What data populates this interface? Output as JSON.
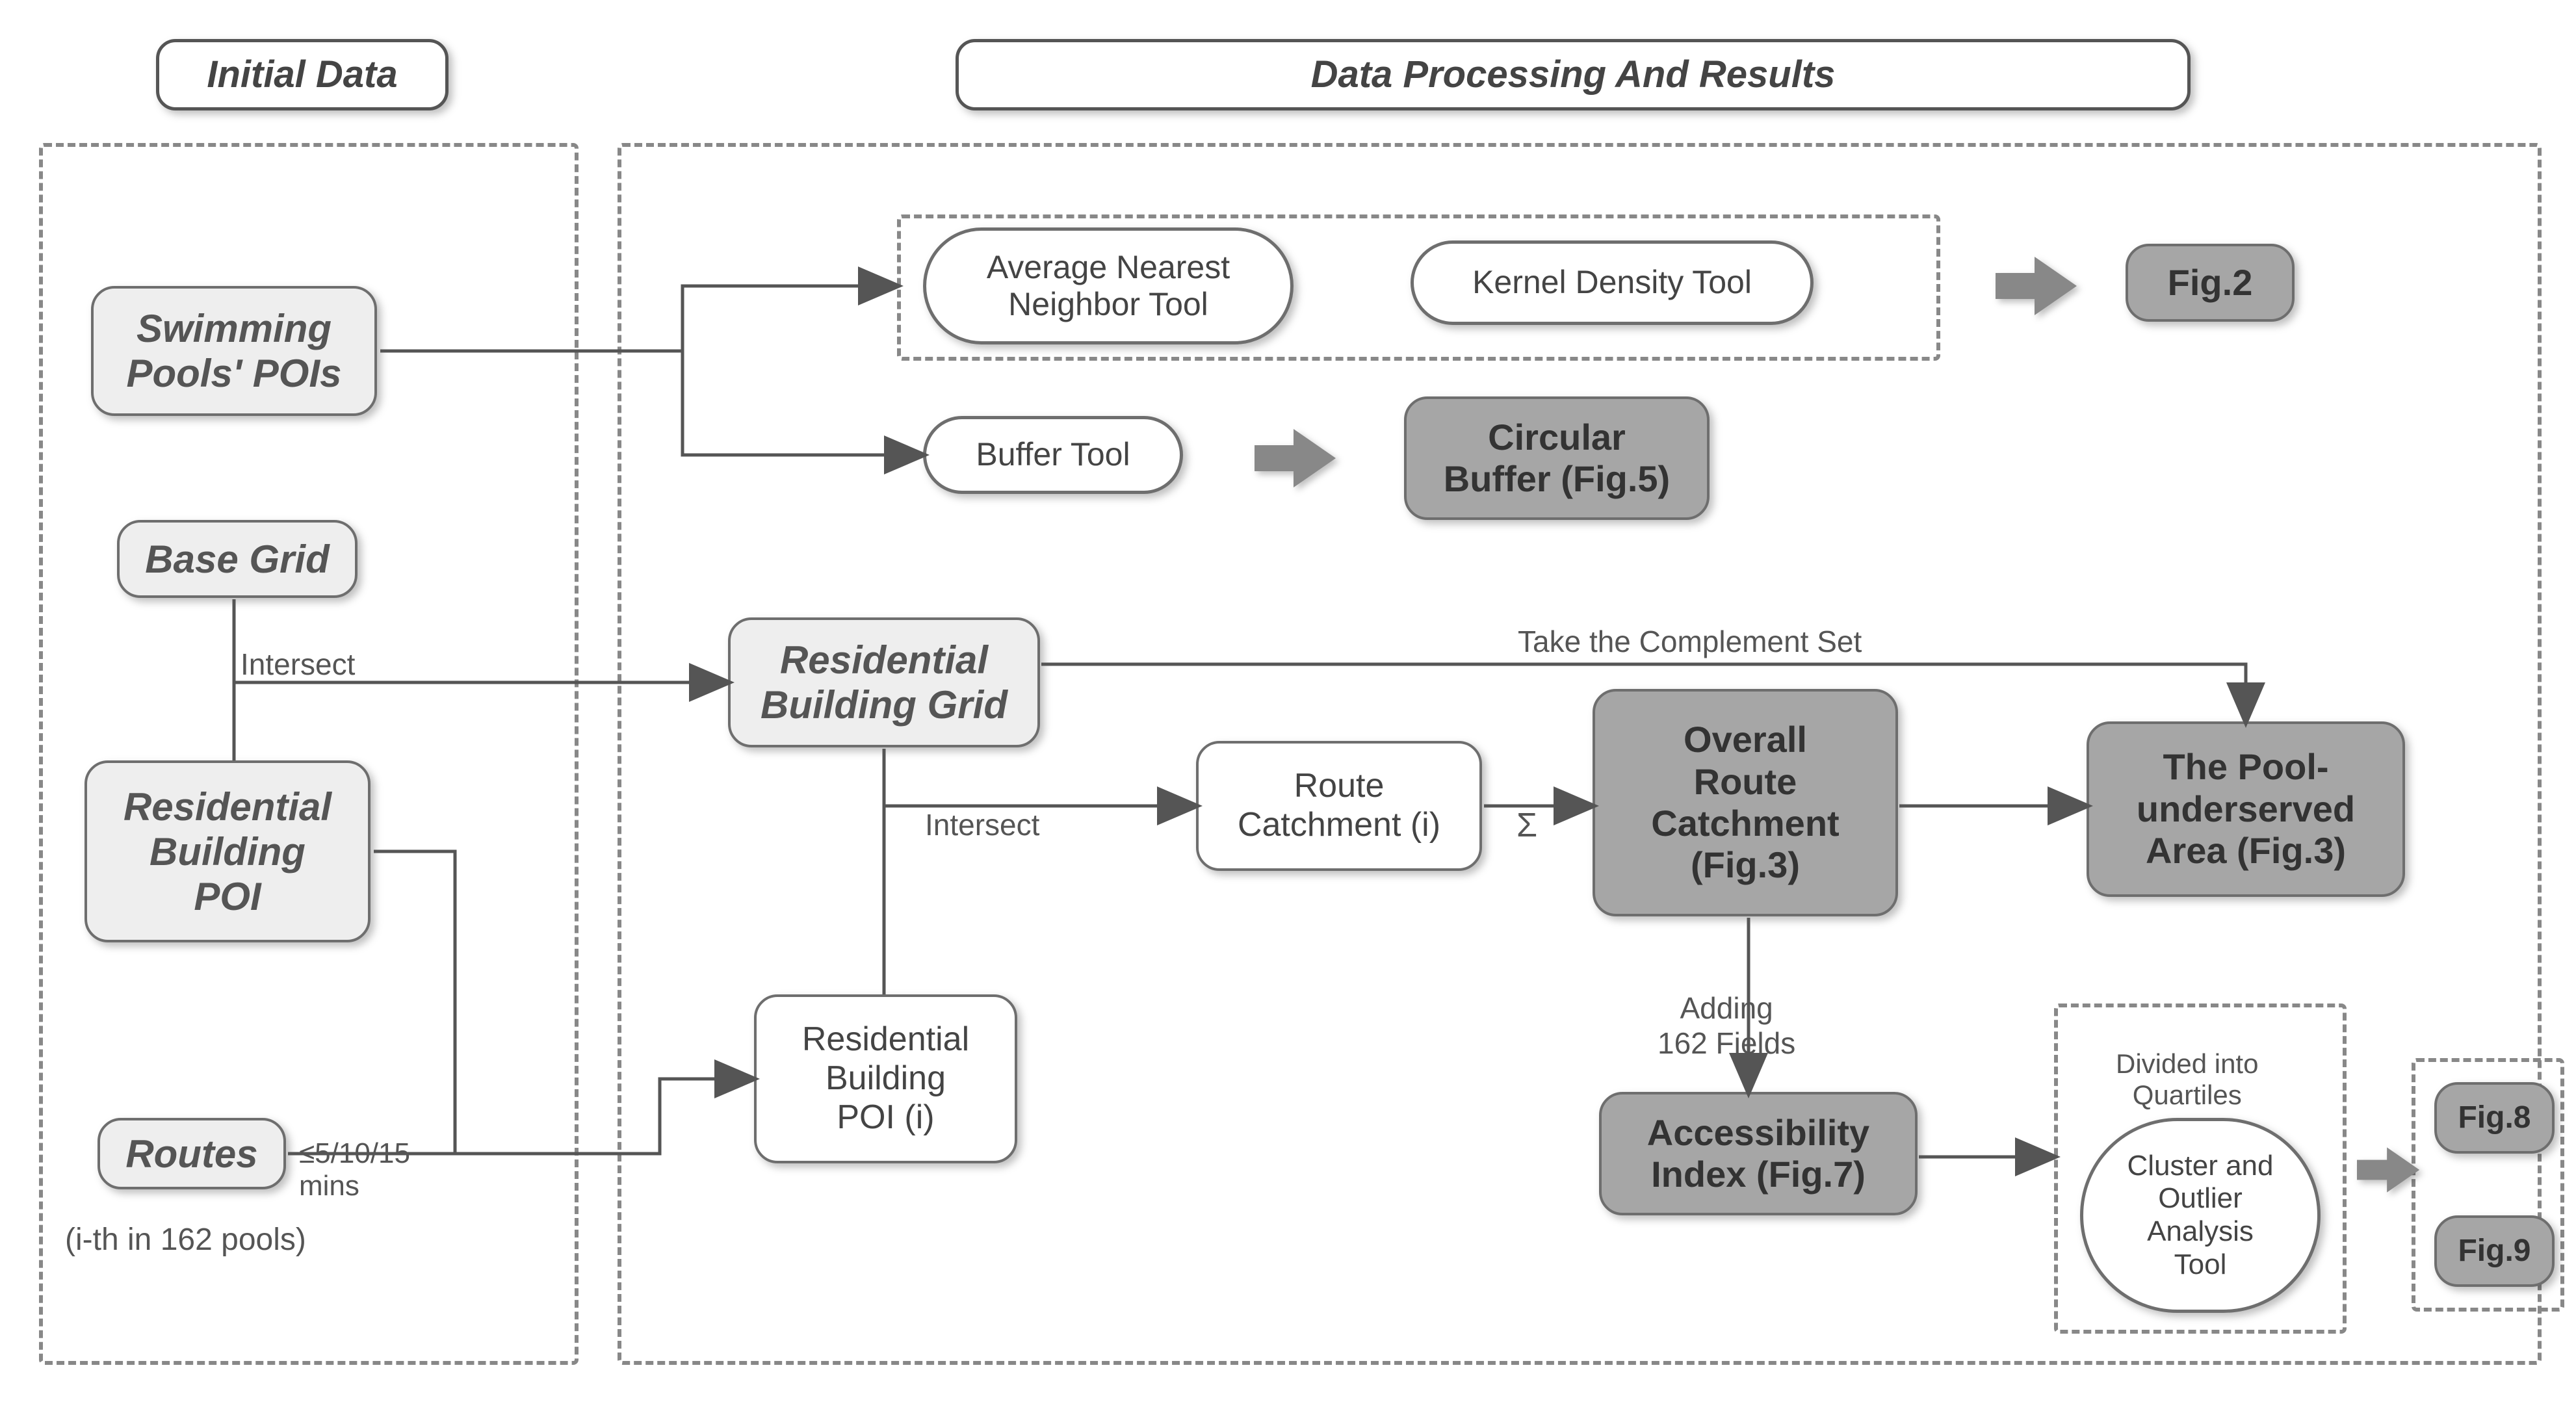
{
  "headers": {
    "initial": "Initial Data",
    "processing": "Data Processing And Results"
  },
  "nodes": {
    "swimming_pools": "Swimming\nPools' POIs",
    "base_grid": "Base Grid",
    "residential_poi": "Residential\nBuilding\nPOI",
    "routes": "Routes",
    "res_building_grid": "Residential\nBuilding Grid",
    "res_building_poi_i": "Residential\nBuilding\nPOI (i)",
    "route_catchment_i": "Route\nCatchment (i)",
    "overall_route": "Overall\nRoute\nCatchment\n(Fig.3)",
    "underserved": "The Pool-\nunderserved\nArea (Fig.3)",
    "accessibility": "Accessibility\nIndex (Fig.7)",
    "circular_buffer": "Circular\nBuffer (Fig.5)",
    "fig2": "Fig.2",
    "fig8": "Fig.8",
    "fig9": "Fig.9",
    "avg_nn_tool": "Average Nearest\nNeighbor Tool",
    "kernel_tool": "Kernel Density Tool",
    "buffer_tool": "Buffer Tool",
    "cluster_tool": "Cluster and\nOutlier\nAnalysis\nTool"
  },
  "labels": {
    "intersect1": "Intersect",
    "intersect2": "Intersect",
    "sigma": "Σ",
    "take_complement": "Take the Complement Set",
    "adding_fields": "Adding\n162 Fields",
    "quartiles": "Divided into\nQuartiles",
    "routes_cond": "≤5/10/15\nmins",
    "ith": "(i-th in 162 pools)"
  }
}
